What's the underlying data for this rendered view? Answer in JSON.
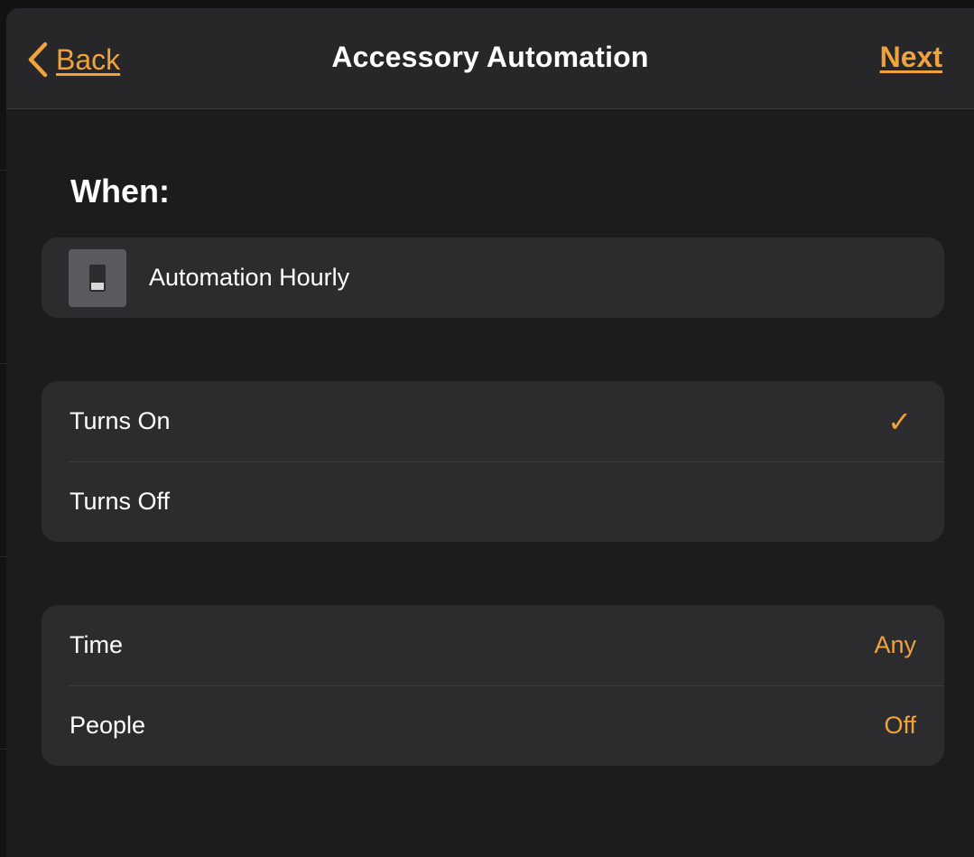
{
  "navbar": {
    "back_label": "Back",
    "title": "Accessory Automation",
    "next_label": "Next"
  },
  "when": {
    "heading": "When:",
    "accessory_name": "Automation Hourly",
    "accessory_icon": "light-switch-icon"
  },
  "trigger_options": [
    {
      "label": "Turns On",
      "selected": true
    },
    {
      "label": "Turns Off",
      "selected": false
    }
  ],
  "conditions": [
    {
      "label": "Time",
      "value": "Any"
    },
    {
      "label": "People",
      "value": "Off"
    }
  ],
  "colors": {
    "accent": "#f0a23b",
    "background": "#1c1c1e",
    "cell": "#2c2c2e",
    "navbar": "#272729"
  }
}
